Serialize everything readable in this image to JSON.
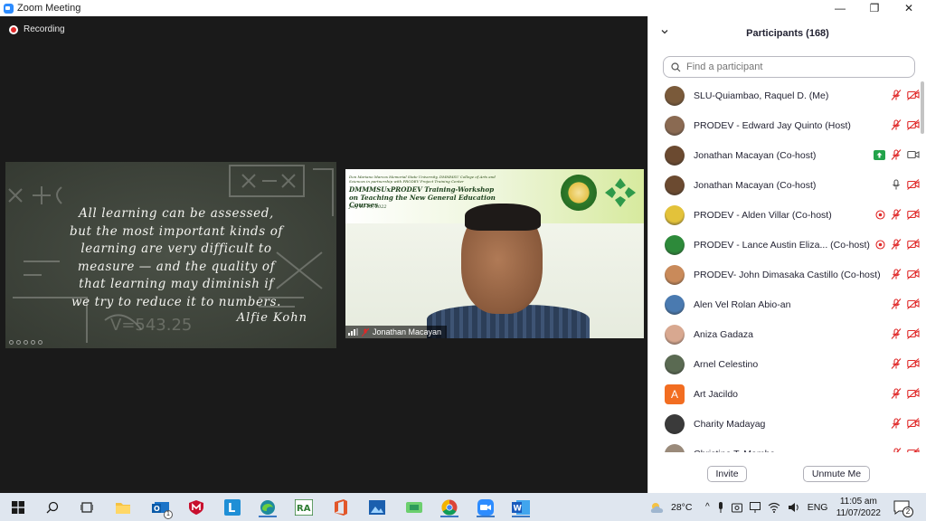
{
  "window": {
    "title": "Zoom Meeting",
    "minimize": "—",
    "maximize": "❐",
    "close": "✕"
  },
  "meeting": {
    "recording_label": "Recording",
    "share": {
      "quote_lines": [
        "All learning can be assessed,",
        "but the most important kinds of",
        "learning are very difficult to",
        "measure — and the quality of",
        "that learning may diminish if",
        "we try to reduce it to numbers."
      ],
      "author": "Alfie Kohn"
    },
    "video": {
      "participant_name": "Jonathan Macayan",
      "banner_small": "Don Mariano Marcos Memorial State University, DMMMSU College of Arts and Sciences in partnership with PRODEV Project Training Center",
      "banner_title": "DMMMSUxPRODEV Training-Workshop on Teaching the New General Education Courses",
      "banner_date": "July 13-15, 2022"
    }
  },
  "participants_panel": {
    "title": "Participants (168)",
    "search_placeholder": "Find a participant",
    "invite_label": "Invite",
    "unmute_label": "Unmute Me",
    "participants": [
      {
        "name": "SLU-Quiambao, Raquel D. (Me)",
        "avatar": "#7a5a3a",
        "icons": [
          "mic-muted",
          "video-off"
        ]
      },
      {
        "name": "PRODEV - Edward Jay Quinto (Host)",
        "avatar": "#8a6a52",
        "icons": [
          "mic-muted",
          "video-off"
        ]
      },
      {
        "name": "Jonathan Macayan (Co-host)",
        "avatar": "#6b4a30",
        "icons": [
          "share-screen",
          "mic-muted",
          "video-on"
        ]
      },
      {
        "name": "Jonathan Macayan (Co-host)",
        "avatar": "#6b4a30",
        "icons": [
          "mic-on",
          "video-off"
        ]
      },
      {
        "name": "PRODEV - Alden Villar (Co-host)",
        "avatar": "#e3c23a",
        "icons": [
          "record",
          "mic-muted",
          "video-off"
        ]
      },
      {
        "name": "PRODEV - Lance Austin Eliza... (Co-host)",
        "avatar": "#2d8a3a",
        "icons": [
          "record",
          "mic-muted",
          "video-off"
        ]
      },
      {
        "name": "PRODEV- John Dimasaka Castillo (Co-host)",
        "avatar": "#c98a5a",
        "icons": [
          "mic-muted",
          "video-off"
        ]
      },
      {
        "name": "Alen Vel Rolan Abio-an",
        "avatar": "#4a7ab0",
        "icons": [
          "mic-muted",
          "video-off"
        ]
      },
      {
        "name": "Aniza Gadaza",
        "avatar": "#d8a890",
        "icons": [
          "mic-muted",
          "video-off"
        ]
      },
      {
        "name": "Arnel Celestino",
        "avatar": "#5a6a52",
        "icons": [
          "mic-muted",
          "video-off"
        ]
      },
      {
        "name": "Art Jacildo",
        "avatar_letter": "A",
        "avatar": "#f26d21",
        "icons": [
          "mic-muted",
          "video-off"
        ]
      },
      {
        "name": "Charity Madayag",
        "avatar": "#3a3a3a",
        "icons": [
          "mic-muted",
          "video-off"
        ]
      },
      {
        "name": "Christine T. Mamba",
        "avatar": "#9a8a7a",
        "icons": [
          "mic-muted",
          "video-off"
        ]
      }
    ]
  },
  "taskbar": {
    "weather": "28°C",
    "language": "ENG",
    "time": "11:05 am",
    "date": "11/07/2022",
    "notification_count": "2",
    "outlook_badge": "1"
  },
  "colors": {
    "zoom_blue": "#2d8cff",
    "muted_red": "#e02828",
    "share_green": "#22a34a",
    "taskbar": "#dfe6ef"
  }
}
